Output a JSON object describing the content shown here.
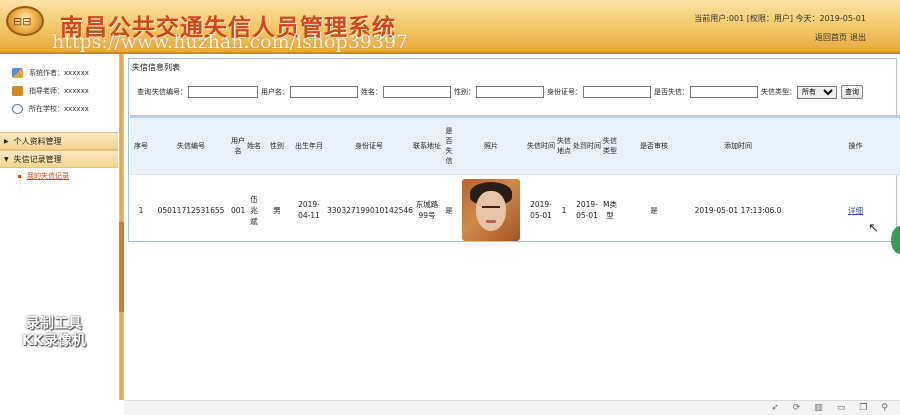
{
  "header": {
    "title": "南昌公共交通失信人员管理系统",
    "watermark": "https://www.huzhan.com/ishop39397",
    "user_info": "当前用户:001 [权限：用户] 今天：2019-05-01",
    "links": [
      "返回首页",
      "退出"
    ]
  },
  "sidebar": {
    "info": [
      {
        "icon": "people-icon",
        "text": "系统作者：xxxxxx"
      },
      {
        "icon": "teacher-icon",
        "text": "指导老师：xxxxxx"
      },
      {
        "icon": "school-icon",
        "text": "所在学校：xxxxxx"
      }
    ],
    "menus": [
      {
        "label": "个人资料管理"
      },
      {
        "label": "失信记录管理"
      }
    ],
    "submenu": "我的失信记录"
  },
  "panel": {
    "title": "失信信息列表",
    "search": {
      "prefix": "查询",
      "fields": [
        "失信编号：",
        "用户名：",
        "姓名：",
        "性别：",
        "身份证号：",
        "是否失信："
      ],
      "type_label": "失信类型：",
      "type_value": "所有",
      "button": "查询"
    }
  },
  "table": {
    "headers": [
      "序号",
      "失信编号",
      "用户名",
      "姓名",
      "性别",
      "出生年月",
      "身份证号",
      "联系地址",
      "是否失信",
      "照片",
      "失信时间",
      "失信地点",
      "处罚时间",
      "失信类型",
      "是否审核",
      "添加时间",
      "操作"
    ],
    "rows": [
      {
        "c0": "1",
        "c1": "05011712531655",
        "c2": "001",
        "c3": "伍兆斌",
        "c4": "男",
        "c5": "2019-04-11",
        "c6": "330327199010142546",
        "c7": "东城路99号",
        "c8": "是",
        "c10": "2019-05-01",
        "c11": "1",
        "c12": "2019-05-01",
        "c13": "M类型",
        "c14": "是",
        "c15": "2019-05-01 17:13:06.0",
        "c16": "详细"
      }
    ]
  },
  "recorder_badge": [
    "录制工具",
    "KK录像机"
  ]
}
